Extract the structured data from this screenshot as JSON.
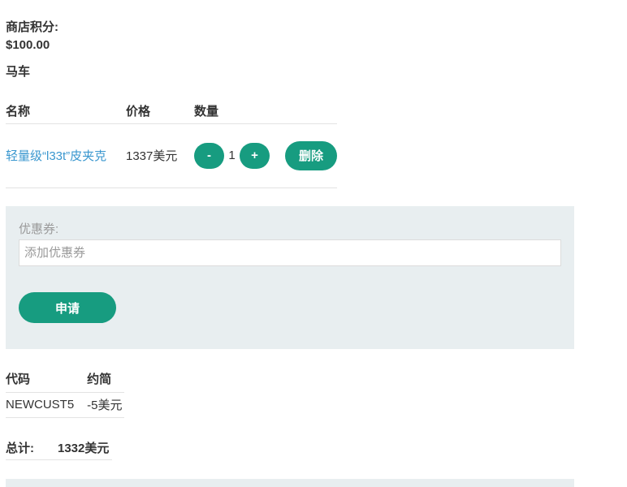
{
  "store_credit": {
    "label": "商店积分:",
    "value": "$100.00"
  },
  "cart": {
    "title": "马车",
    "headers": {
      "name": "名称",
      "price": "价格",
      "quantity": "数量"
    },
    "items": [
      {
        "name": "轻量级“l33t”皮夹克",
        "price": "1337美元",
        "quantity": "1",
        "decrement_label": "-",
        "increment_label": "+",
        "remove_label": "删除"
      }
    ]
  },
  "coupon": {
    "label": "优惠券:",
    "placeholder": "添加优惠券",
    "value": "",
    "apply_label": "申请"
  },
  "applied_coupons": {
    "headers": {
      "code": "代码",
      "savings": "约简"
    },
    "rows": [
      {
        "code": "NEWCUST5",
        "savings": "-5美元"
      }
    ]
  },
  "total": {
    "label": "总计:",
    "value": "1332美元"
  },
  "colors": {
    "accent": "#179c80",
    "link": "#3a97cf",
    "panel": "#e8eef0"
  }
}
